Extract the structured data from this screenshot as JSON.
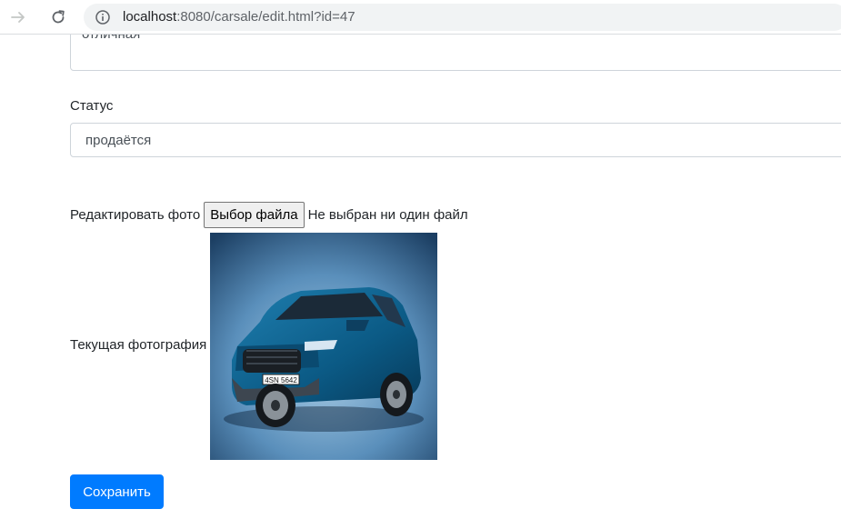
{
  "browser": {
    "url_host": "localhost",
    "url_rest": ":8080/carsale/edit.html?id=47",
    "icons": [
      "forward-arrow-icon",
      "reload-icon",
      "info-icon"
    ]
  },
  "form": {
    "description_value": "отличная",
    "status_label": "Статус",
    "status_value": "продаётся",
    "edit_photo_label": "Редактировать фото",
    "file_button_label": "Выбор файла",
    "file_status": "Не выбран ни один файл",
    "current_photo_label": "Текущая фотография",
    "save_label": "Сохранить",
    "photo_plate_text": "4SN 5642"
  },
  "colors": {
    "primary": "#007bff",
    "border": "#ced4da",
    "text": "#212529"
  }
}
